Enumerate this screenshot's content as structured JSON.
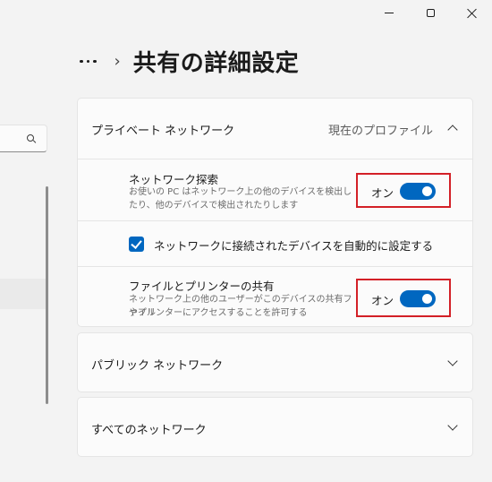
{
  "breadcrumb": {
    "title": "共有の詳細設定"
  },
  "private_network": {
    "label": "プライベート ネットワーク",
    "profile_label": "現在のプロファイル",
    "discovery": {
      "title": "ネットワーク探索",
      "desc_line1": "お使いの PC はネットワーク上の他のデバイスを検出し",
      "desc_line2": "たり、他のデバイスで検出されたりします",
      "state": "オン",
      "value": true
    },
    "auto_setup": {
      "label": "ネットワークに接続されたデバイスを自動的に設定する",
      "checked": true
    },
    "file_sharing": {
      "title": "ファイルとプリンターの共有",
      "desc_line1": "ネットワーク上の他のユーザーがこのデバイスの共有ファイル",
      "desc_line2": "やプリンターにアクセスすることを許可する",
      "state": "オン",
      "value": true
    }
  },
  "public_network": {
    "label": "パブリック ネットワーク"
  },
  "all_networks": {
    "label": "すべてのネットワーク"
  },
  "colors": {
    "accent": "#0067c0",
    "highlight_border": "#d32027"
  },
  "icons": [
    "minimize-icon",
    "maximize-icon",
    "close-icon",
    "search-icon",
    "more-icon",
    "chevron-right-icon",
    "chevron-up-icon",
    "chevron-down-icon",
    "check-icon"
  ]
}
